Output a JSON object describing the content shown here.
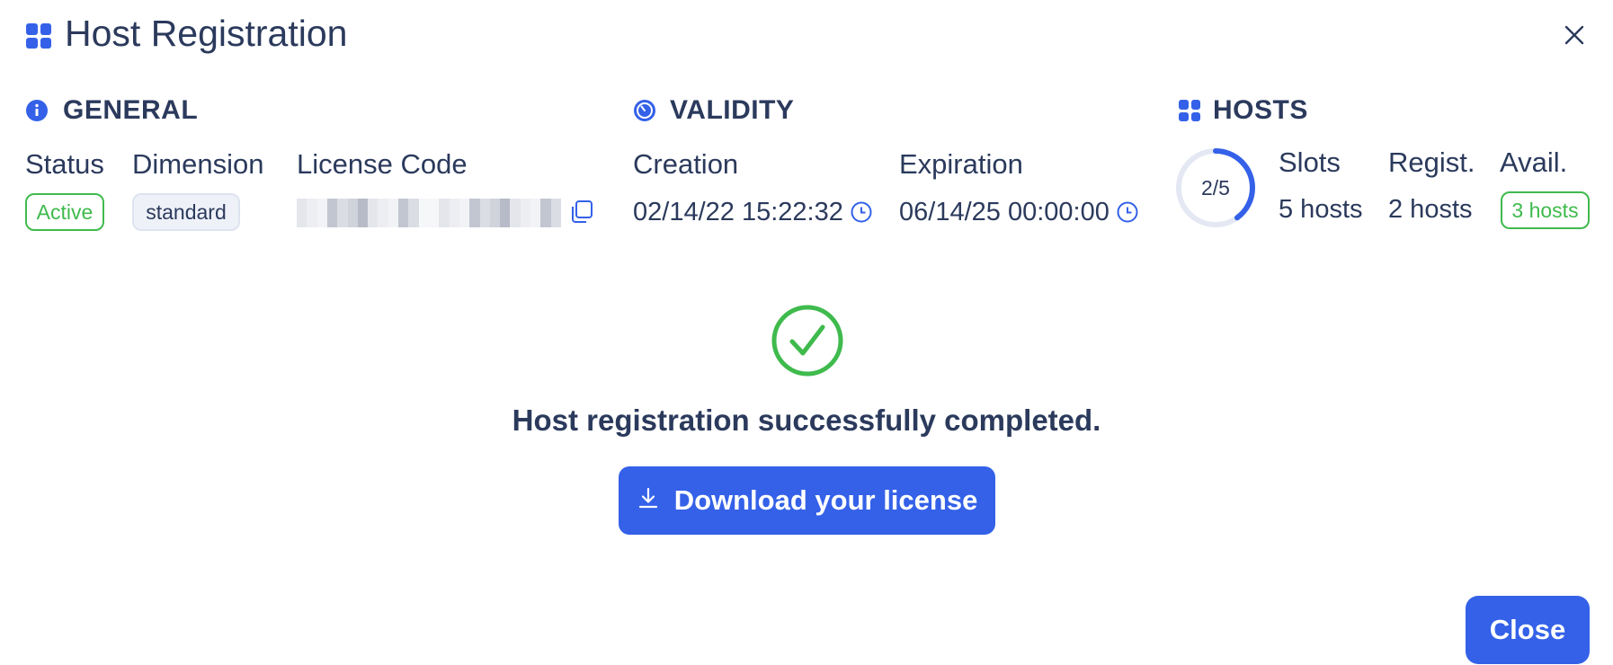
{
  "dialog": {
    "title": "Host Registration",
    "close_icon": "close-icon"
  },
  "general": {
    "heading": "GENERAL",
    "icon": "info-icon",
    "status_label": "Status",
    "status_value": "Active",
    "dimension_label": "Dimension",
    "dimension_value": "standard",
    "license_label": "License Code",
    "license_value_obscured": true,
    "copy_icon": "copy-icon"
  },
  "validity": {
    "heading": "VALIDITY",
    "icon": "stopwatch-icon",
    "creation_label": "Creation",
    "creation_value": "02/14/22 15:22:32",
    "expiration_label": "Expiration",
    "expiration_value": "06/14/25 00:00:00",
    "clock_icon": "clock-icon"
  },
  "hosts": {
    "heading": "HOSTS",
    "icon": "grid-icon",
    "gauge_text": "2/5",
    "gauge_fraction": 0.4,
    "slots_label": "Slots",
    "slots_value": "5 hosts",
    "registered_label": "Regist.",
    "registered_value": "2 hosts",
    "available_label": "Avail.",
    "available_value": "3 hosts"
  },
  "result": {
    "icon": "check-circle-icon",
    "message": "Host registration successfully completed.",
    "download_label": "Download your license",
    "download_icon": "download-icon"
  },
  "footer": {
    "close_label": "Close"
  },
  "colors": {
    "accent": "#3461e8",
    "text": "#2b3a5c",
    "success": "#3fba4d",
    "muted_track": "#e3e8f2"
  }
}
